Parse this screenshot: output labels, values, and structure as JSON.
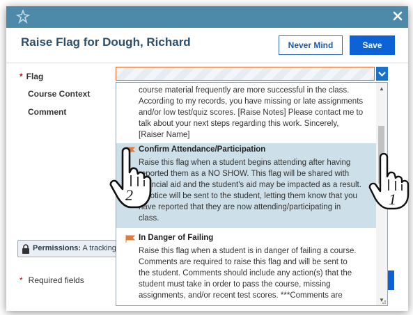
{
  "titlebar": {
    "color": "#4d8aa9",
    "pin_icon": "pin-icon",
    "close_icon": "close-icon"
  },
  "dialog": {
    "title": "Raise Flag for Dough, Richard",
    "never_mind_label": "Never Mind",
    "save_label": "Save"
  },
  "form": {
    "flag_label": "Flag",
    "course_context_label": "Course Context",
    "comment_label": "Comment",
    "required_star": "*",
    "permissions_label": "Permissions:",
    "permissions_text": "A tracking",
    "required_fields_label": "Required fields"
  },
  "dropdown": {
    "prev_fragment": [
      "course material frequently are more successful in the class.",
      "According to my records, you have missing or late assignments",
      "and/or low test/quiz scores. [Raise Notes] Please contact me to",
      "talk about your next steps regarding this work. Sincerely,",
      "[Raiser Name]"
    ],
    "items": [
      {
        "title": "Confirm Attendance/Participation",
        "desc": [
          "Raise this flag when a student begins attending after having",
          "reported them as a NO SHOW. This flag will be shared with",
          "financial aid and the student's aid may be impacted as a result.",
          "A notice will be sent to the student, letting them know that you",
          "have reported that they are now attending/participating in",
          "class."
        ]
      },
      {
        "title": "In Danger of Failing",
        "desc": [
          "Raise this flag when a student is in danger of failing a course.",
          "Comments are required to raise this flag and will be sent to",
          "the student. Comments should include any action(s) that the",
          "student must take in order to pass the course, missing",
          "assignments, and/or recent test scores. ***Comments are"
        ]
      }
    ]
  },
  "annotations": {
    "step_1": "1",
    "step_2": "2"
  },
  "colors": {
    "accent": "#0d63d6",
    "highlight": "#cddfe8",
    "flag_icon": "#e07b39",
    "required": "#b5121b"
  }
}
